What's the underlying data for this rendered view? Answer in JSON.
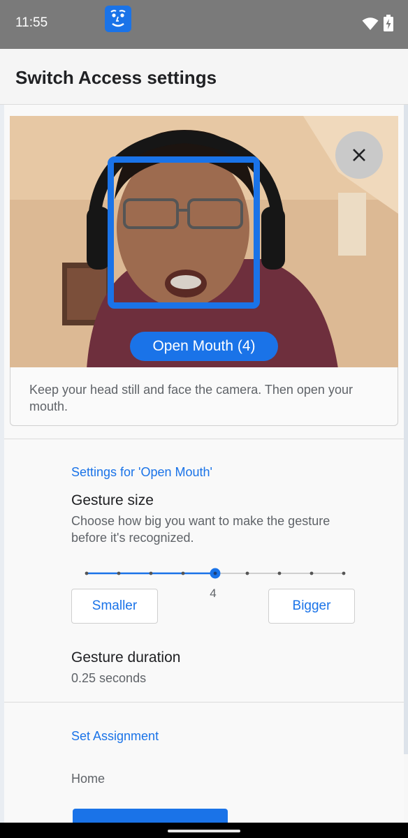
{
  "status_bar": {
    "time": "11:55",
    "icons": [
      "app-face-icon",
      "wifi-icon",
      "battery-charging-icon"
    ]
  },
  "app_bar": {
    "title": "Switch Access settings"
  },
  "camera_preview": {
    "gesture_chip": "Open Mouth (4)",
    "close_icon": "close-icon",
    "instruction": "Keep your head still and face the camera. Then open your mouth."
  },
  "gesture_settings": {
    "header": "Settings for 'Open Mouth'",
    "size": {
      "title": "Gesture size",
      "description": "Choose how big you want to make the gesture before it's recognized.",
      "value": "4",
      "level": 5,
      "steps": 9,
      "smaller_label": "Smaller",
      "bigger_label": "Bigger"
    },
    "duration": {
      "title": "Gesture duration",
      "value": "0.25 seconds"
    }
  },
  "assignment": {
    "header": "Set Assignment",
    "value": "Home"
  },
  "colors": {
    "accent": "#1a73e8",
    "status_bar": "#7a7a7a",
    "background": "#f7f7f7"
  }
}
